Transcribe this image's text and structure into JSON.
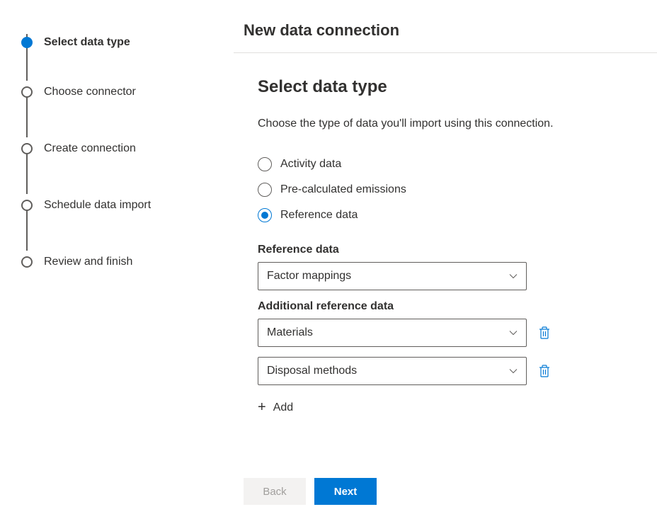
{
  "header": {
    "title": "New data connection"
  },
  "steps": [
    {
      "label": "Select data type",
      "active": true
    },
    {
      "label": "Choose connector",
      "active": false
    },
    {
      "label": "Create connection",
      "active": false
    },
    {
      "label": "Schedule data import",
      "active": false
    },
    {
      "label": "Review and finish",
      "active": false
    }
  ],
  "section": {
    "title": "Select data type",
    "description": "Choose the type of data you'll import using this connection."
  },
  "radios": [
    {
      "label": "Activity data",
      "selected": false
    },
    {
      "label": "Pre-calculated emissions",
      "selected": false
    },
    {
      "label": "Reference data",
      "selected": true
    }
  ],
  "reference": {
    "label": "Reference data",
    "value": "Factor mappings"
  },
  "additional": {
    "label": "Additional reference data",
    "items": [
      {
        "value": "Materials"
      },
      {
        "value": "Disposal methods"
      }
    ]
  },
  "add_label": "Add",
  "buttons": {
    "back": "Back",
    "next": "Next"
  }
}
